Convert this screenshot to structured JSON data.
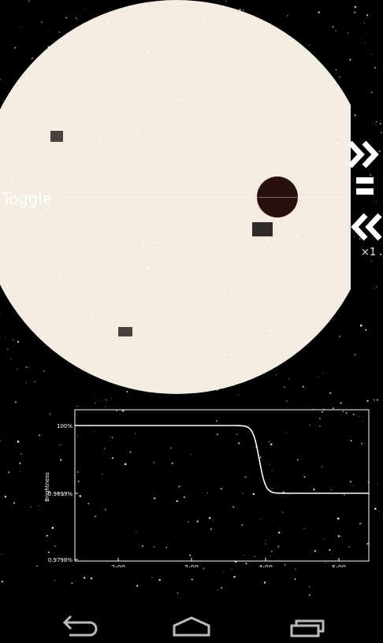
{
  "overlay": {
    "toggle_label": "Toggle",
    "speed_label": "×1"
  },
  "icons": {
    "fast_forward": "fast-forward-icon",
    "pause": "pause-icon",
    "rewind": "rewind-icon",
    "back": "back-icon",
    "home": "home-icon",
    "recents": "recent-apps-icon"
  },
  "colors": {
    "sky": "#000000",
    "sun": "#f4ece1",
    "planet": "#2a0f0f",
    "sunspot": "#1f1a18",
    "chart_line": "#ffffff"
  },
  "chart_data": {
    "type": "line",
    "title": "",
    "xlabel": "",
    "ylabel": "Brightness",
    "x_tick_labels": [
      "2:00",
      "3:00",
      "4:00",
      "5:00"
    ],
    "y_tick_labels": [
      "100%",
      "0.9899%",
      "0.9798%"
    ],
    "x_range_minutes": [
      95,
      215
    ],
    "y_range": [
      0.9798,
      1.0
    ],
    "series": [
      {
        "x_minutes": [
          95,
          150,
          200,
          239,
          240,
          241,
          242,
          243,
          245,
          247,
          250,
          255,
          260,
          270,
          215
        ],
        "values": []
      }
    ]
  }
}
